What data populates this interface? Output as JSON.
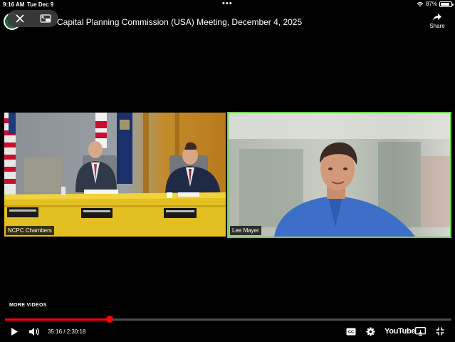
{
  "status_bar": {
    "time": "9:16 AM",
    "date": "Tue Dec 9",
    "menu_dots": "•••",
    "battery_text": "87%",
    "battery_level": 0.87
  },
  "header": {
    "title": "Capital Planning Commission (USA) Meeting, December 4, 2025",
    "share_label": "Share"
  },
  "left_feed": {
    "label": "NCPC Chambers"
  },
  "right_feed": {
    "label": "Lee Mayer"
  },
  "player": {
    "more_videos": "MORE VIDEOS",
    "current_time": "35:16",
    "duration": "2:30:18",
    "timecode": "35:16 / 2:30:18",
    "progress_fraction": 0.2344,
    "youtube_label": "YouTube",
    "accent_color": "#ff0000"
  },
  "icons": [
    "close-icon",
    "pip-icon",
    "share-icon",
    "play-icon",
    "volume-icon",
    "captions-icon",
    "settings-icon",
    "cast-icon",
    "exit-fullscreen-icon",
    "wifi-icon",
    "battery-icon"
  ]
}
